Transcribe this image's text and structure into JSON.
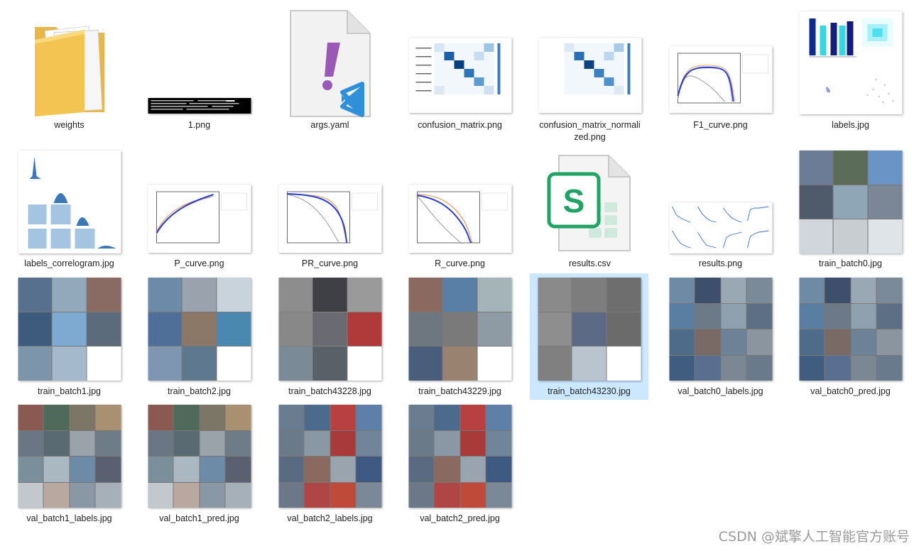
{
  "files": [
    {
      "name": "weights",
      "type": "folder"
    },
    {
      "name": "1.png",
      "type": "terminal-image"
    },
    {
      "name": "args.yaml",
      "type": "yaml-file"
    },
    {
      "name": "confusion_matrix.png",
      "type": "heatmap-image"
    },
    {
      "name": "confusion_matrix_normalized.png",
      "type": "heatmap-image"
    },
    {
      "name": "F1_curve.png",
      "type": "curve-image"
    },
    {
      "name": "labels.jpg",
      "type": "labels-image"
    },
    {
      "name": "labels_correlogram.jpg",
      "type": "correlogram-image"
    },
    {
      "name": "P_curve.png",
      "type": "curve-image"
    },
    {
      "name": "PR_curve.png",
      "type": "curve-image"
    },
    {
      "name": "R_curve.png",
      "type": "curve-image"
    },
    {
      "name": "results.csv",
      "type": "csv-file"
    },
    {
      "name": "results.png",
      "type": "results-image"
    },
    {
      "name": "train_batch0.jpg",
      "type": "mosaic-image"
    },
    {
      "name": "train_batch1.jpg",
      "type": "mosaic-image"
    },
    {
      "name": "train_batch2.jpg",
      "type": "mosaic-image"
    },
    {
      "name": "train_batch43228.jpg",
      "type": "mosaic-image"
    },
    {
      "name": "train_batch43229.jpg",
      "type": "mosaic-image"
    },
    {
      "name": "train_batch43230.jpg",
      "type": "mosaic-image",
      "selected": true
    },
    {
      "name": "val_batch0_labels.jpg",
      "type": "mosaic-image"
    },
    {
      "name": "val_batch0_pred.jpg",
      "type": "mosaic-image"
    },
    {
      "name": "val_batch1_labels.jpg",
      "type": "mosaic-image"
    },
    {
      "name": "val_batch1_pred.jpg",
      "type": "mosaic-image"
    },
    {
      "name": "val_batch2_labels.jpg",
      "type": "mosaic-image"
    },
    {
      "name": "val_batch2_pred.jpg",
      "type": "mosaic-image"
    }
  ],
  "watermark": "CSDN @斌擎人工智能官方账号",
  "colors": {
    "selection": "#cce8ff",
    "folder": "#f3c451",
    "vscode": "#2f8fd8",
    "csv": "#21a366"
  }
}
